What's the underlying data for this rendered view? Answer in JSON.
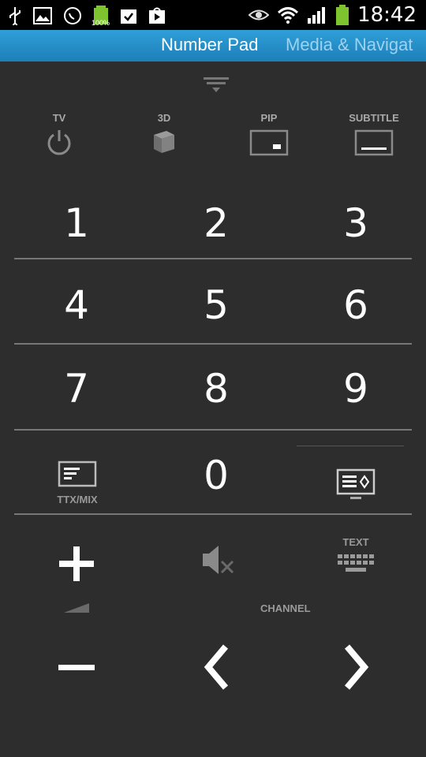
{
  "status_bar": {
    "battery_percent": "100%",
    "time": "18:42"
  },
  "tabs": {
    "active": "Number Pad",
    "inactive": "Media & Navigat"
  },
  "functions": {
    "tv": "TV",
    "three_d": "3D",
    "pip": "PIP",
    "subtitle": "SUBTITLE"
  },
  "numbers": [
    "1",
    "2",
    "3",
    "4",
    "5",
    "6",
    "7",
    "8",
    "9",
    "0"
  ],
  "bottom": {
    "ttx_label": "TTX/MIX",
    "text_label": "TEXT",
    "channel_label": "CHANNEL"
  },
  "colors": {
    "background": "#2d2d2d",
    "tab_bar": "#2f9fd8",
    "divider": "#777777"
  }
}
